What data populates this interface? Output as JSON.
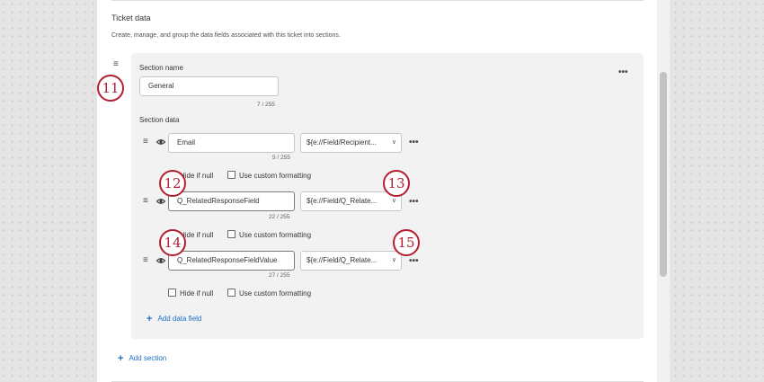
{
  "ticket_data": {
    "title": "Ticket data",
    "description": "Create, manage, and group the data fields associated with this ticket into sections."
  },
  "section": {
    "name_label": "Section name",
    "name_value": "General",
    "name_counter": "7 / 255",
    "data_label": "Section data",
    "more_icon": "•••",
    "fields": [
      {
        "value": "Email",
        "counter": "5 / 255",
        "mapping": "${e://Field/Recipient...",
        "hide_if_null": "Hide if null",
        "custom_formatting": "Use custom formatting"
      },
      {
        "value": "Q_RelatedResponseField",
        "counter": "22 / 255",
        "mapping": "${e://Field/Q_Relate...",
        "hide_if_null": "Hide if null",
        "custom_formatting": "Use custom formatting"
      },
      {
        "value": "Q_RelatedResponseFieldValue",
        "counter": "27 / 255",
        "mapping": "${e://Field/Q_Relate...",
        "hide_if_null": "Hide if null",
        "custom_formatting": "Use custom formatting"
      }
    ],
    "add_data_field": "Add data field"
  },
  "add_section": "Add section",
  "callouts": [
    "11",
    "12",
    "13",
    "14",
    "15"
  ],
  "icons": {
    "drag": "≡",
    "chevron": "∨",
    "plus": "+"
  },
  "colors": {
    "accent_link": "#1a6fc2",
    "callout": "#b51e32"
  }
}
